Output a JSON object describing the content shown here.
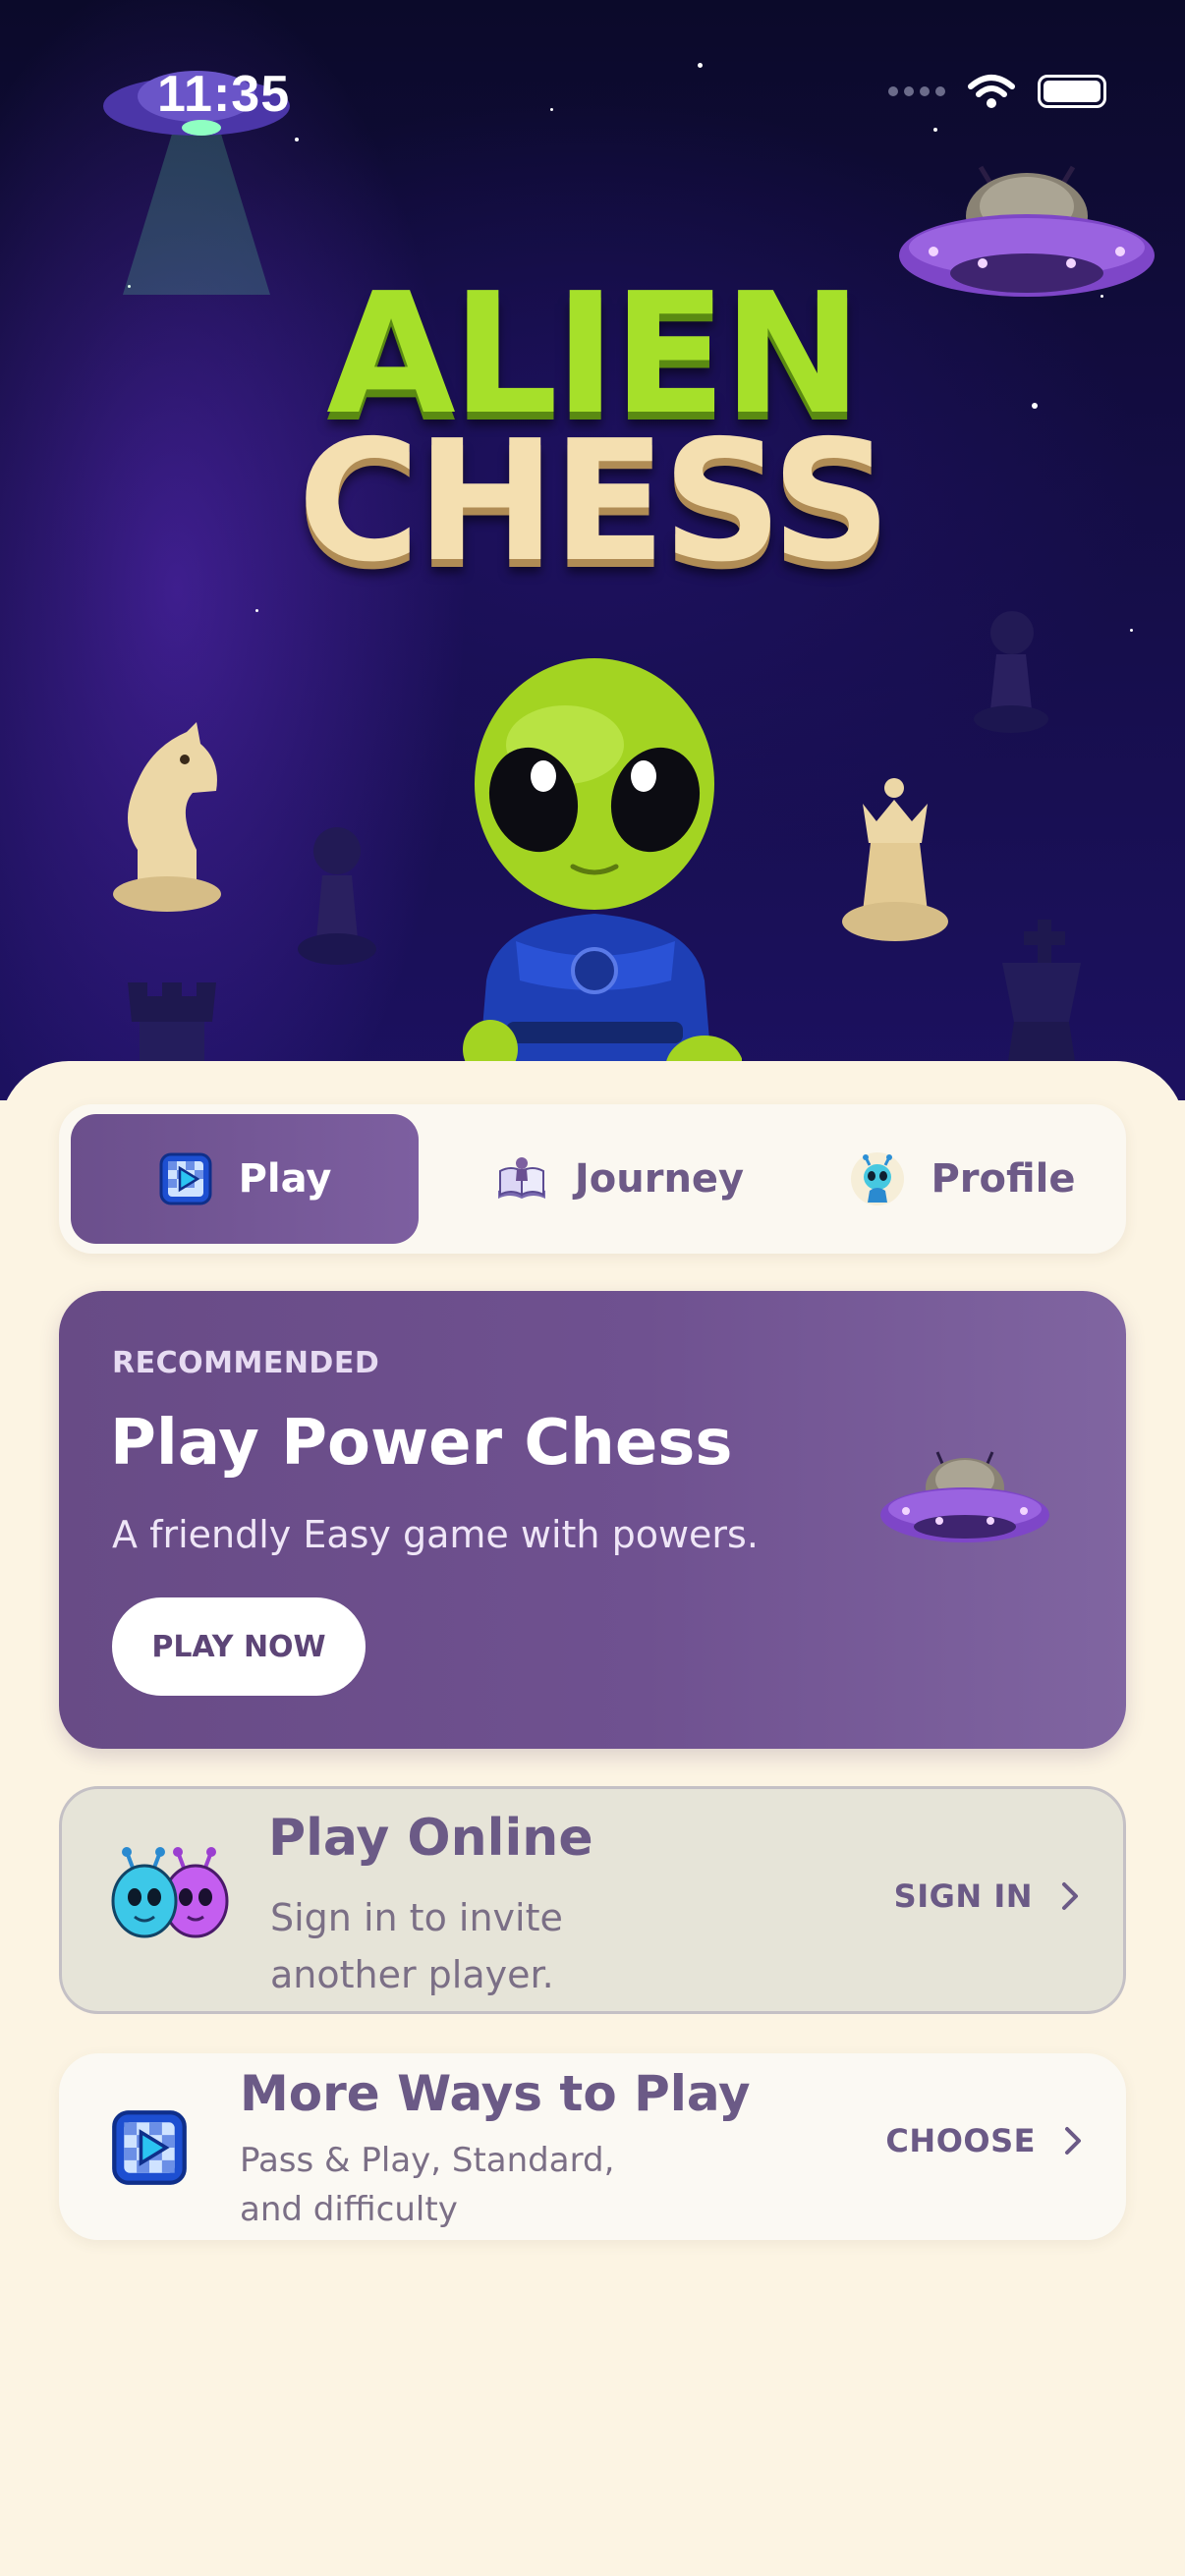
{
  "status_bar": {
    "time": "11:35"
  },
  "hero": {
    "title_line1": "ALIEN",
    "title_line2": "CHESS"
  },
  "tabs": [
    {
      "label": "Play",
      "icon": "play-board-icon",
      "selected": true
    },
    {
      "label": "Journey",
      "icon": "storybook-icon",
      "selected": false
    },
    {
      "label": "Profile",
      "icon": "alien-avatar-icon",
      "selected": false
    }
  ],
  "recommended": {
    "eyebrow": "RECOMMENDED",
    "title": "Play Power Chess",
    "subtitle": "A friendly Easy game with powers.",
    "button_label": "PLAY NOW"
  },
  "play_online": {
    "title": "Play Online",
    "subtitle": "Sign in to invite another player.",
    "action_label": "SIGN IN"
  },
  "more_ways": {
    "title": "More Ways to Play",
    "subtitle": "Pass & Play, Standard, and difficulty",
    "action_label": "CHOOSE"
  },
  "colors": {
    "accent_purple": "#6f5190",
    "alien_green": "#a6e02a",
    "cream_bg": "#fcf4e3",
    "hero_night": "#140d45"
  }
}
